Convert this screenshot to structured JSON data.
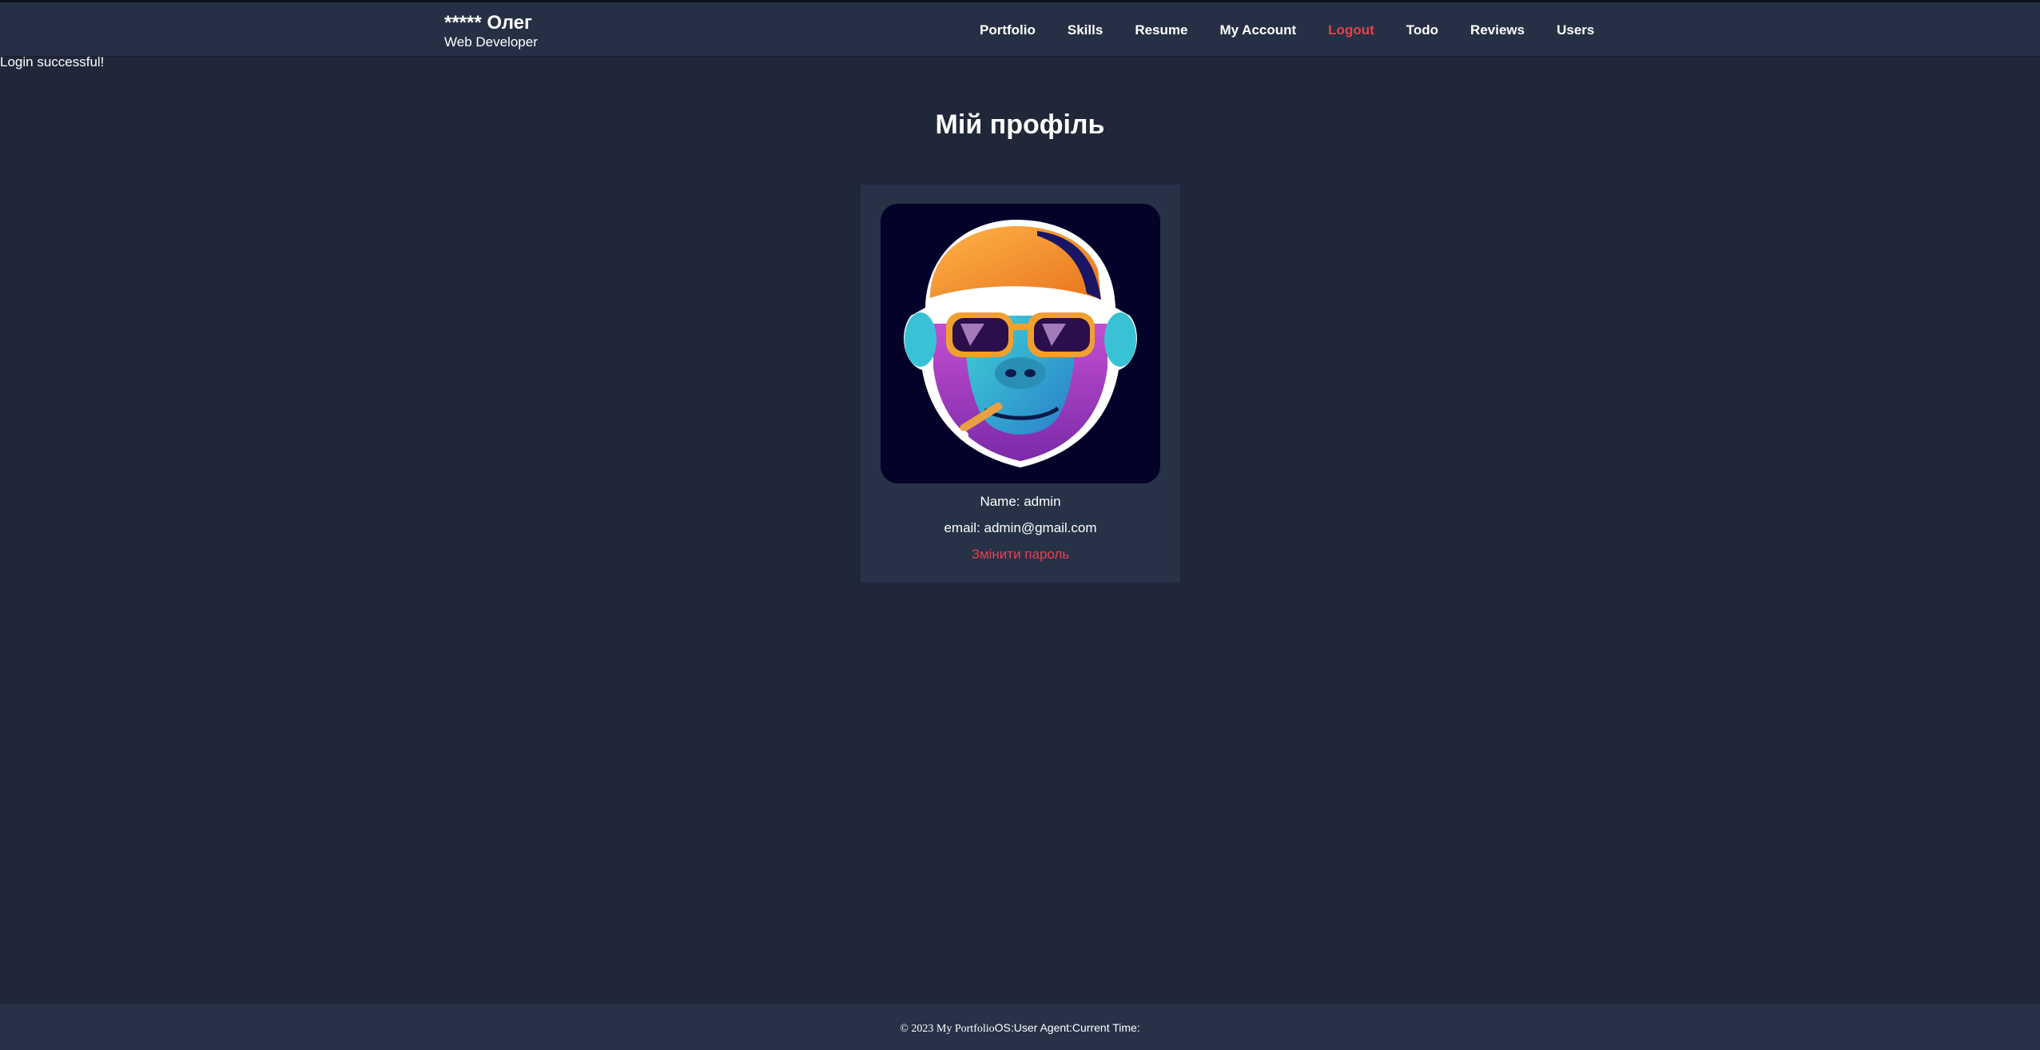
{
  "header": {
    "brand_name": "***** Олег",
    "brand_subtitle": "Web Developer",
    "nav": [
      {
        "label": "Portfolio"
      },
      {
        "label": "Skills"
      },
      {
        "label": "Resume"
      },
      {
        "label": "My Account"
      },
      {
        "label": "Logout"
      },
      {
        "label": "Todo"
      },
      {
        "label": "Reviews"
      },
      {
        "label": "Users"
      }
    ]
  },
  "flash_message": "Login successful!",
  "profile": {
    "title": "Мій профіль",
    "avatar_icon": "monkey-avatar-icon",
    "name_line": "Name: admin",
    "email_line": "email: admin@gmail.com",
    "change_password": "Змінити пароль"
  },
  "footer": {
    "copyright": "© 2023 My Portfolio",
    "os": "OS:",
    "user_agent": "User Agent:",
    "current_time": "Current Time:"
  },
  "colors": {
    "background": "#1f2739",
    "header": "#253044",
    "card": "#273247",
    "accent": "#e8404f"
  }
}
